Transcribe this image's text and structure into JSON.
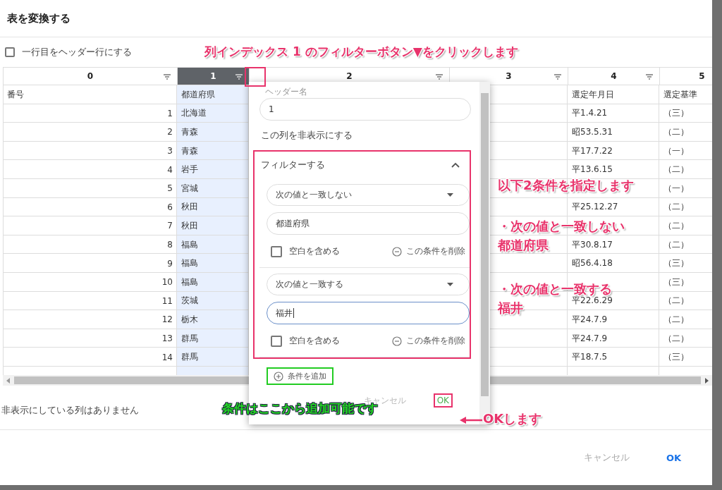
{
  "dialog": {
    "title": "表を変換する"
  },
  "header_row_option": {
    "label": "一行目をヘッダー行にする",
    "checked": false
  },
  "table": {
    "columns": [
      {
        "label": "0",
        "selected": false
      },
      {
        "label": "1",
        "selected": true
      },
      {
        "label": "2",
        "selected": false
      },
      {
        "label": "3",
        "selected": false
      },
      {
        "label": "4",
        "selected": false
      },
      {
        "label": "5",
        "selected": false
      }
    ],
    "rows": [
      {
        "column_0": "番号",
        "column_1": "都道府県",
        "column_4": "選定年月日",
        "column_5": "選定基準"
      },
      {
        "column_0": "1",
        "column_1": "北海道",
        "column_4": "平1.4.21",
        "column_5": "（三）"
      },
      {
        "column_0": "2",
        "column_1": "青森",
        "column_4": "昭53.5.31",
        "column_5": "（二）"
      },
      {
        "column_0": "3",
        "column_1": "青森",
        "column_4": "平17.7.22",
        "column_5": "（一）"
      },
      {
        "column_0": "4",
        "column_1": "岩手",
        "column_4": "平13.6.15",
        "column_5": "（二）"
      },
      {
        "column_0": "5",
        "column_1": "宮城",
        "column_5": "（一）"
      },
      {
        "column_0": "6",
        "column_1": "秋田",
        "column_4": "平25.12.27",
        "column_5": "（二）"
      },
      {
        "column_0": "7",
        "column_1": "秋田",
        "column_5": "（二）"
      },
      {
        "column_0": "8",
        "column_1": "福島",
        "column_4": "平30.8.17",
        "column_5": "（二）"
      },
      {
        "column_0": "9",
        "column_1": "福島",
        "column_4": "昭56.4.18",
        "column_5": "（三）"
      },
      {
        "column_0": "10",
        "column_1": "福島",
        "column_5": "（三）"
      },
      {
        "column_0": "11",
        "column_1": "茨城",
        "column_4": "平22.6.29",
        "column_5": "（二）"
      },
      {
        "column_0": "12",
        "column_1": "栃木",
        "column_4": "平24.7.9",
        "column_5": "（二）"
      },
      {
        "column_0": "13",
        "column_1": "群馬",
        "column_4": "平24.7.9",
        "column_5": "（二）"
      },
      {
        "column_0": "14",
        "column_1": "群馬",
        "column_4": "平18.7.5",
        "column_5": "（三）"
      }
    ]
  },
  "column_menu": {
    "header_name_label": "ヘッダー名",
    "header_name_value": "1",
    "hide_column": "この列を非表示にする",
    "filter": {
      "title": "フィルターする",
      "expanded": true,
      "conditions": [
        {
          "operator": "次の値と一致しない",
          "value": "都道府県",
          "focused": false,
          "include_blank": {
            "label": "空白を含める",
            "checked": false
          },
          "remove": "この条件を削除"
        },
        {
          "operator": "次の値と一致する",
          "value": "福井",
          "focused": true,
          "include_blank": {
            "label": "空白を含める",
            "checked": false
          },
          "remove": "この条件を削除"
        }
      ],
      "add_condition": "条件を追加"
    },
    "cancel": "キャンセル",
    "ok": "OK"
  },
  "hidden_columns_note": "非表示にしている列はありません",
  "footer": {
    "cancel": "キャンセル",
    "ok": "OK"
  },
  "annotations": [
    {
      "color": "#e8336b",
      "lines": [
        "列インデックス 1 のフィルターボタン▼をクリックします"
      ]
    },
    {
      "color": "#e8336b",
      "lines": [
        "以下2条件を指定します"
      ]
    },
    {
      "color": "#e8336b",
      "lines": [
        "・次の値と一致しない",
        "都道府県"
      ]
    },
    {
      "color": "#e8336b",
      "lines": [
        "・次の値と一致する",
        "福井"
      ]
    },
    {
      "color": "#22d822",
      "lines": [
        "条件はここから追加可能です"
      ]
    },
    {
      "color": "#e8336b",
      "lines": [
        "OKします"
      ]
    }
  ]
}
